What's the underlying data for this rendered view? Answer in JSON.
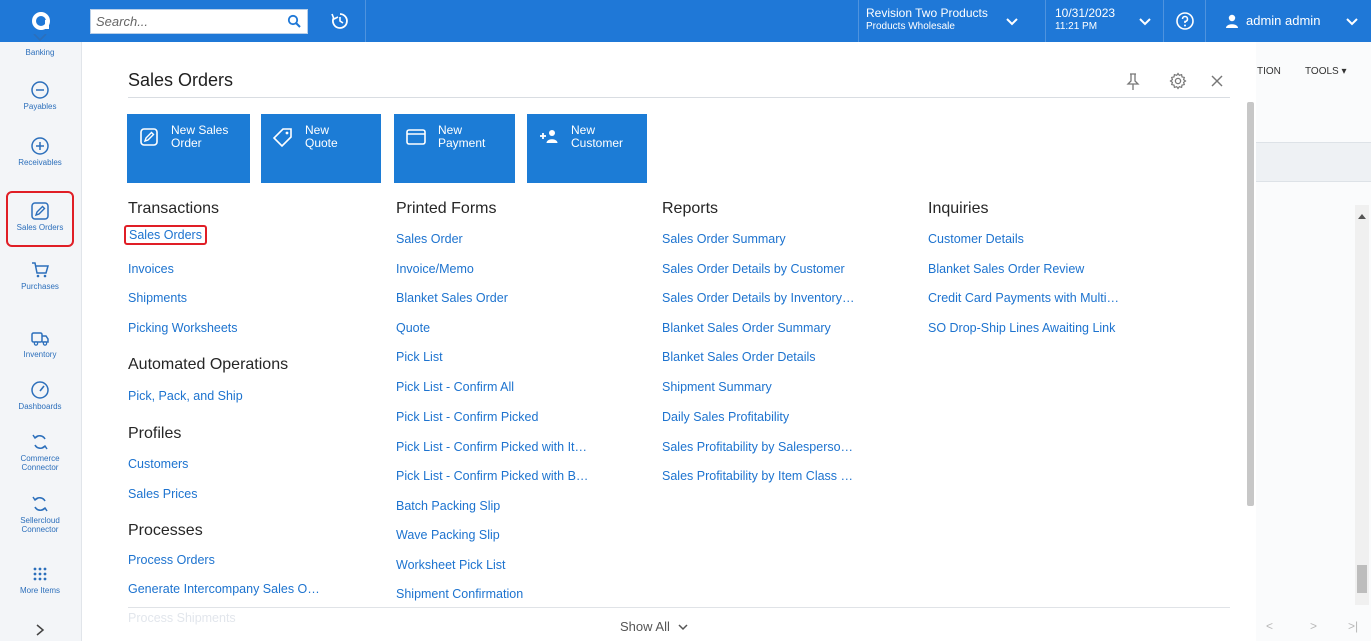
{
  "topbar": {
    "search_placeholder": "Search...",
    "branch_main": "Revision Two Products",
    "branch_sub": "Products Wholesale",
    "date_main": "10/31/2023",
    "date_sub": "11:21 PM",
    "user_name": "admin admin",
    "brand_color": "#1f78d7"
  },
  "sidebar": {
    "items": [
      {
        "label": "Banking",
        "icon": "bank-icon"
      },
      {
        "label": "Payables",
        "icon": "minus-circle-icon"
      },
      {
        "label": "Receivables",
        "icon": "plus-circle-icon"
      },
      {
        "label": "Sales Orders",
        "icon": "edit-icon"
      },
      {
        "label": "Purchases",
        "icon": "cart-icon"
      },
      {
        "label": "Inventory",
        "icon": "truck-icon"
      },
      {
        "label": "Dashboards",
        "icon": "gauge-icon"
      },
      {
        "label": "Commerce Connector",
        "icon": "sync-icon"
      },
      {
        "label": "Sellercloud Connector",
        "icon": "sync-icon"
      },
      {
        "label": "More Items",
        "icon": "grid-icon"
      }
    ],
    "active": "Sales Orders"
  },
  "background": {
    "tab1": "TION",
    "tab2": "TOOLS ▾",
    "pager": [
      "<",
      ">",
      ">|"
    ]
  },
  "panel": {
    "title": "Sales Orders",
    "quick_actions": [
      {
        "line1": "New Sales",
        "line2": "Order",
        "icon": "edit-icon"
      },
      {
        "line1": "New",
        "line2": "Quote",
        "icon": "tag-icon"
      },
      {
        "line1": "New",
        "line2": "Payment",
        "icon": "card-icon"
      },
      {
        "line1": "New",
        "line2": "Customer",
        "icon": "add-user-icon"
      }
    ],
    "transactions": {
      "heading": "Transactions",
      "links": [
        "Sales Orders",
        "Invoices",
        "Shipments",
        "Picking Worksheets"
      ]
    },
    "automated": {
      "heading": "Automated Operations",
      "links": [
        "Pick, Pack, and Ship"
      ]
    },
    "profiles": {
      "heading": "Profiles",
      "links": [
        "Customers",
        "Sales Prices"
      ]
    },
    "processes": {
      "heading": "Processes",
      "links": [
        "Process Orders",
        "Generate Intercompany Sales O…",
        "Process Shipments"
      ]
    },
    "printed_forms": {
      "heading": "Printed Forms",
      "links": [
        "Sales Order",
        "Invoice/Memo",
        "Blanket Sales Order",
        "Quote",
        "Pick List",
        "Pick List - Confirm All",
        "Pick List - Confirm Picked",
        "Pick List - Confirm Picked with It…",
        "Pick List - Confirm Picked with B…",
        "Batch Packing Slip",
        "Wave Packing Slip",
        "Worksheet Pick List",
        "Shipment Confirmation"
      ]
    },
    "reports": {
      "heading": "Reports",
      "links": [
        "Sales Order Summary",
        "Sales Order Details by Customer",
        "Sales Order Details by Inventory…",
        "Blanket Sales Order Summary",
        "Blanket Sales Order Details",
        "Shipment Summary",
        "Daily Sales Profitability",
        "Sales Profitability by Salesperso…",
        "Sales Profitability by Item Class …"
      ]
    },
    "inquiries": {
      "heading": "Inquiries",
      "links": [
        "Customer Details",
        "Blanket Sales Order Review",
        "Credit Card Payments with Multi…",
        "SO Drop-Ship Lines Awaiting Link"
      ]
    },
    "show_all": "Show All"
  }
}
